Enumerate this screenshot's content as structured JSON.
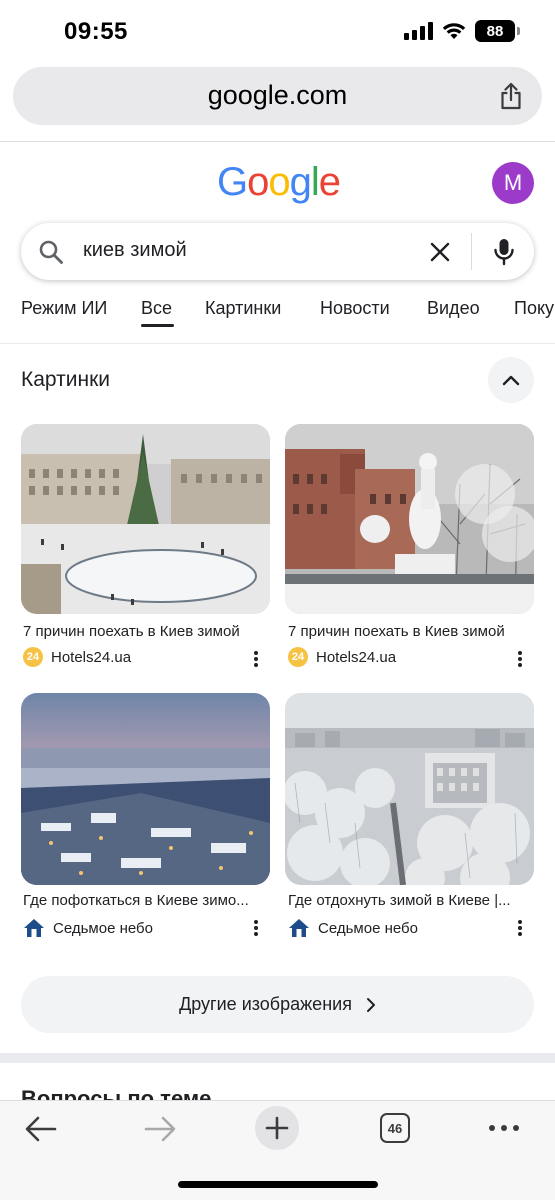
{
  "status_bar": {
    "time": "09:55",
    "battery": "88"
  },
  "browser": {
    "url": "google.com",
    "tab_count": "46"
  },
  "google": {
    "logo_letters": [
      {
        "ch": "G",
        "color": "#4285F4"
      },
      {
        "ch": "o",
        "color": "#EA4335"
      },
      {
        "ch": "o",
        "color": "#FBBC05"
      },
      {
        "ch": "g",
        "color": "#4285F4"
      },
      {
        "ch": "l",
        "color": "#34A853"
      },
      {
        "ch": "e",
        "color": "#EA4335"
      }
    ],
    "avatar_letter": "M",
    "avatar_color": "#9C3BC9"
  },
  "search": {
    "query": "киев зимой"
  },
  "tabs": [
    {
      "label": "Режим ИИ",
      "active": false
    },
    {
      "label": "Все",
      "active": true
    },
    {
      "label": "Картинки",
      "active": false
    },
    {
      "label": "Новости",
      "active": false
    },
    {
      "label": "Видео",
      "active": false
    },
    {
      "label": "Поку",
      "active": false
    }
  ],
  "images_section": {
    "title": "Картинки",
    "results": [
      {
        "title": "7 причин поехать в Киев зимой",
        "source": "Hotels24.ua",
        "favicon": "24"
      },
      {
        "title": "7 причин поехать в Киев зимой",
        "source": "Hotels24.ua",
        "favicon": "24"
      },
      {
        "title": "Где пофоткаться в Киеве зимо...",
        "source": "Седьмое небо",
        "favicon": "house"
      },
      {
        "title": "Где отдохнуть зимой в Киеве |...",
        "source": "Седьмое небо",
        "favicon": "house"
      }
    ],
    "more_label": "Другие изображения"
  },
  "next_section": {
    "title": "Вопросы по теме"
  }
}
